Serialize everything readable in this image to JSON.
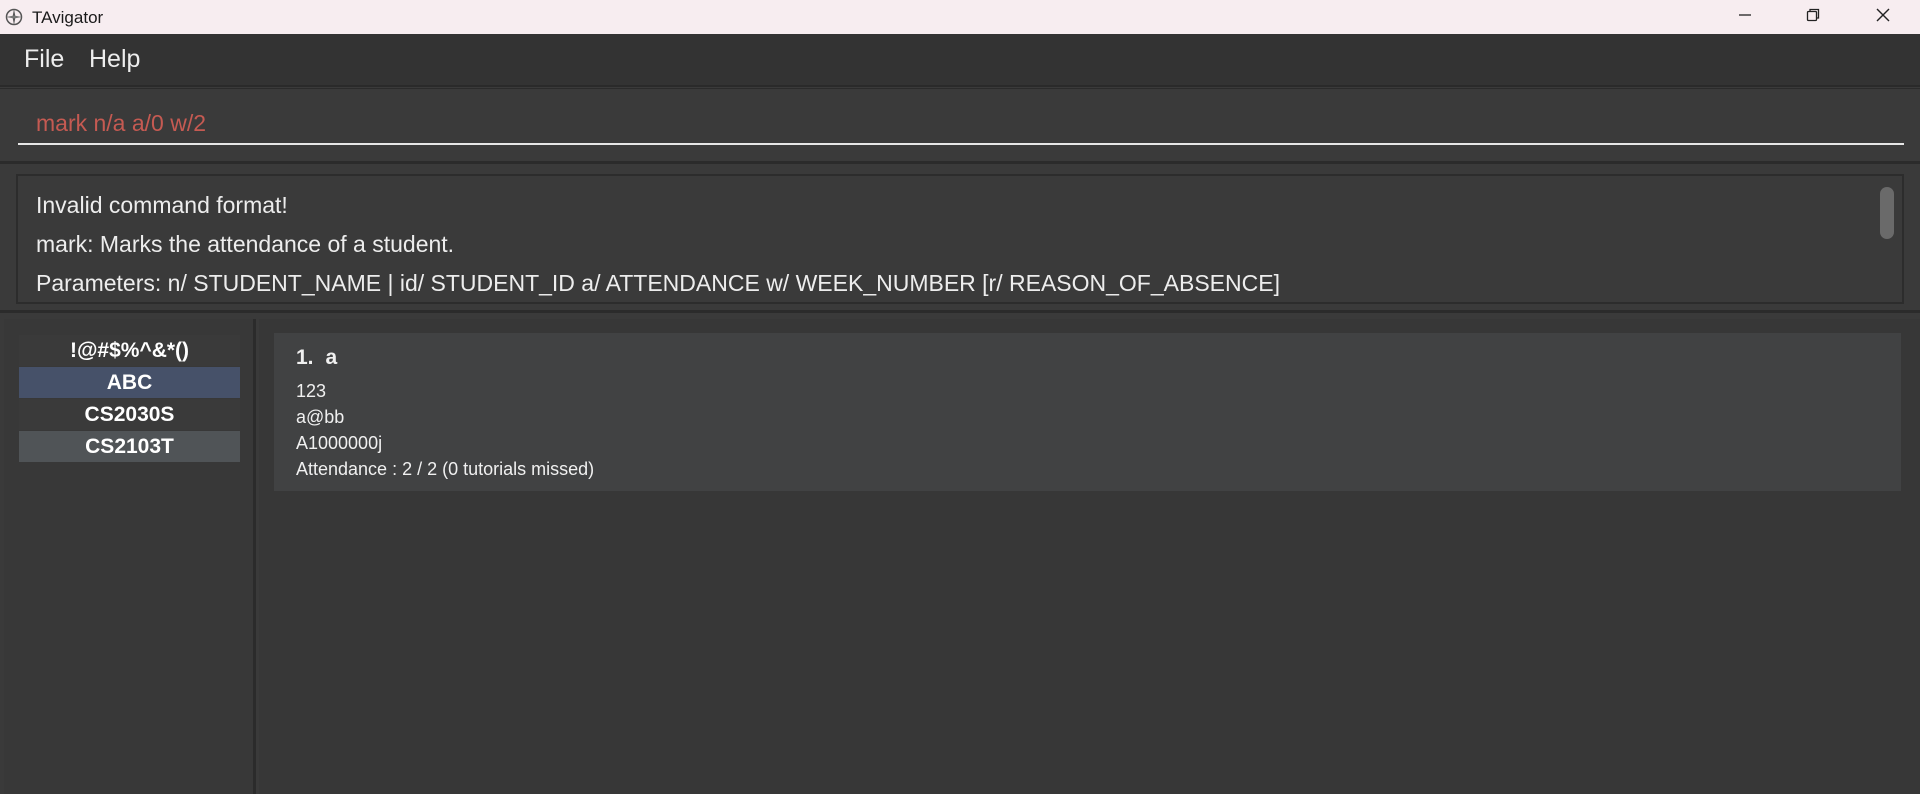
{
  "window": {
    "title": "TAvigator"
  },
  "menu": {
    "file_label": "File",
    "help_label": "Help"
  },
  "command": {
    "value": "mark n/a a/0 w/2"
  },
  "result": {
    "lines": [
      "Invalid command format!",
      "mark: Marks the attendance of a student.",
      "Parameters: n/ STUDENT_NAME | id/ STUDENT_ID a/ ATTENDANCE w/ WEEK_NUMBER [r/ REASON_OF_ABSENCE]"
    ]
  },
  "classes": {
    "items": [
      {
        "label": "!@#$%^&*()",
        "state": "normal"
      },
      {
        "label": "ABC",
        "state": "selected"
      },
      {
        "label": "CS2030S",
        "state": "normal"
      },
      {
        "label": "CS2103T",
        "state": "highlighted"
      }
    ]
  },
  "students": {
    "cards": [
      {
        "index": "1.",
        "name": "a",
        "phone": "123",
        "email": "a@bb",
        "student_id": "A1000000j",
        "attendance": "Attendance : 2 / 2 (0 tutorials missed)"
      }
    ]
  },
  "colors": {
    "titlebar_bg": "#f7edf0",
    "window_bg": "#3a3a3a",
    "command_text_error": "#c55a52",
    "class_selected_bg": "#465169",
    "class_highlighted_bg": "#505457",
    "card_bg": "#414243"
  },
  "icons": {
    "app": "compass-icon",
    "minimize": "minimize-icon",
    "maximize": "restore-icon",
    "close": "close-icon"
  }
}
